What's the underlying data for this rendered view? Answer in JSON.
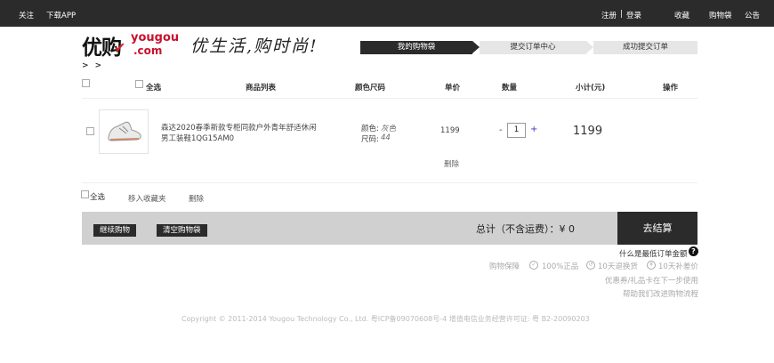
{
  "topbar": {
    "follow": "关注",
    "download_app": "下载APP",
    "register": "注册",
    "divider": "|",
    "login": "登录",
    "favorites": "收藏",
    "shopping_bag": "购物袋",
    "notice": "公告"
  },
  "logo": {
    "cn": "优购",
    "en_line1": "yougou",
    "en_line2": ".com",
    "slogan": "优生活,购时尚!"
  },
  "steps": [
    "我的购物袋",
    "提交订单中心",
    "成功提交订单"
  ],
  "breadcrumb": "> >",
  "table": {
    "select_all": "全选",
    "headers": [
      "商品列表",
      "颜色尺码",
      "单价",
      "数量",
      "小计(元)",
      "操作"
    ]
  },
  "item": {
    "title_line1": "森达2020春季新款专柜同款户外青年舒适休闲",
    "title_line2": "男工装鞋1QG15AM0",
    "color_label": "颜色:",
    "color_value": "灰色",
    "size_label": "尺码:",
    "size_value": "44",
    "unit_price": "1199",
    "qty_minus": "-",
    "qty_value": "1",
    "qty_plus": "+",
    "subtotal": "1199",
    "delete": "删除"
  },
  "footer_actions": {
    "select_all": "全选",
    "move_to_favorites": "移入收藏夹",
    "delete": "删除"
  },
  "summary": {
    "continue_shopping": "继续购物",
    "clear_bag": "清空购物袋",
    "total_label": "总计（不含运费）：¥ 0",
    "checkout": "去结算",
    "min_order": "什么是最低订单金额",
    "help_icon": "?"
  },
  "guarantees": {
    "label": "购物保障",
    "genuine": "100%正品",
    "returns": "10天退换货",
    "price_diff": "10天补差价",
    "coupon_note": "优惠券/礼品卡在下一步使用",
    "improve": "帮助我们改进购物流程"
  },
  "copyright": "Copyright © 2011-2014 Yougou Technology Co., Ltd. 粤ICP备09070608号-4 增值电信业务经营许可证: 粤 B2-20090203"
}
